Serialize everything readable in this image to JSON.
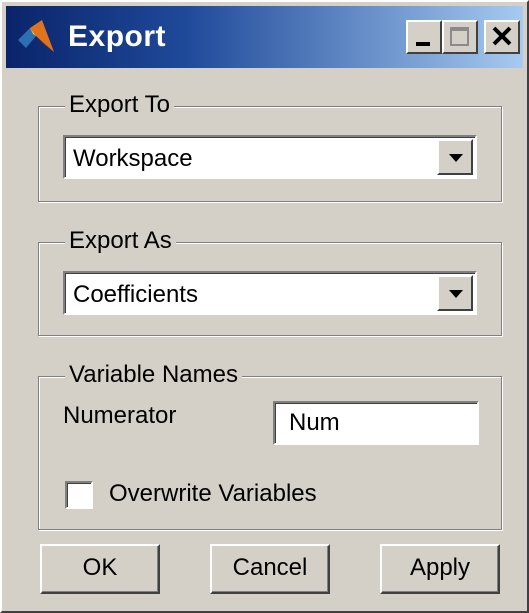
{
  "window": {
    "title": "Export",
    "icon": "matlab-logo-icon",
    "controls": [
      "minimize-icon",
      "maximize-icon",
      "close-icon"
    ]
  },
  "export_to": {
    "legend": "Export To",
    "selected": "Workspace"
  },
  "export_as": {
    "legend": "Export As",
    "selected": "Coefficients"
  },
  "variable_names": {
    "legend": "Variable Names",
    "numerator_label": "Numerator",
    "numerator_value": "Num",
    "overwrite_label": "Overwrite Variables",
    "overwrite_checked": false
  },
  "buttons": {
    "ok": "OK",
    "cancel": "Cancel",
    "apply": "Apply"
  },
  "colors": {
    "titlebar_start": "#0a246a",
    "titlebar_end": "#a6caf0",
    "face": "#d4d0c8"
  }
}
